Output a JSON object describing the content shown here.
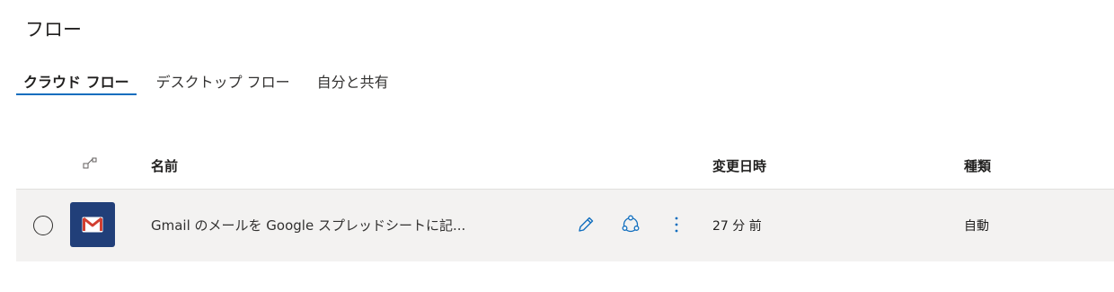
{
  "page": {
    "title": "フロー"
  },
  "tabs": [
    {
      "label": "クラウド フロー",
      "active": true
    },
    {
      "label": "デスクトップ フロー",
      "active": false
    },
    {
      "label": "自分と共有",
      "active": false
    }
  ],
  "table": {
    "columns": {
      "name": "名前",
      "modified": "変更日時",
      "type": "種類"
    },
    "rows": [
      {
        "icon": "gmail-icon",
        "name": "Gmail のメールを Google スプレッドシートに記...",
        "modified": "27 分 前",
        "type": "自動"
      }
    ]
  },
  "colors": {
    "accent": "#106ebe",
    "icon_tile": "#213f79",
    "gmail_red": "#d23f31",
    "row_bg": "#f3f2f1"
  }
}
